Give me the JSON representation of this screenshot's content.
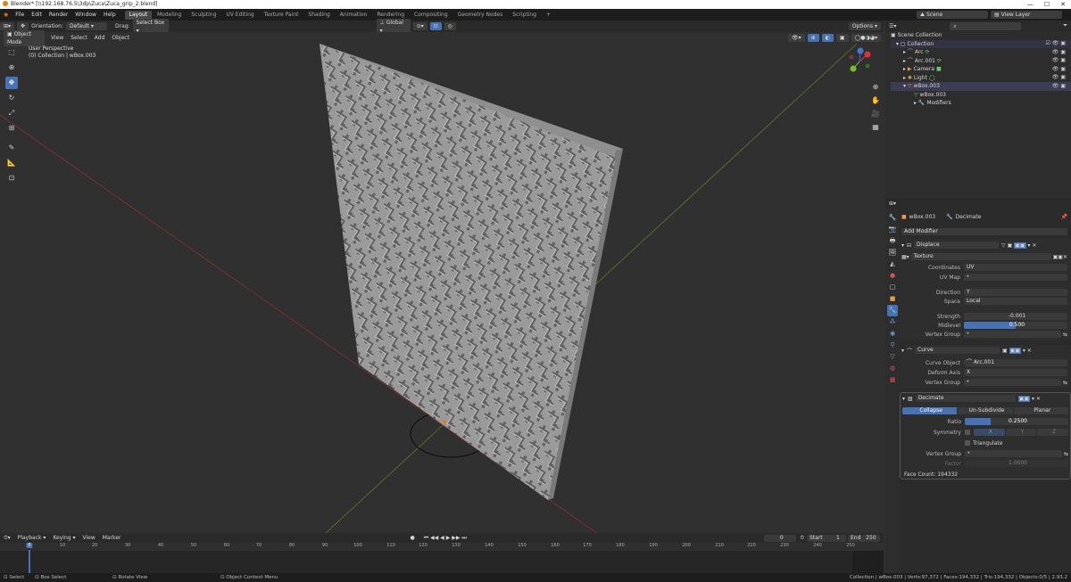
{
  "window": {
    "title": "Blender* [\\\\192.168.76.5\\3dp\\Zuca\\Zuca_grip_2.blend]"
  },
  "menu": [
    "File",
    "Edit",
    "Render",
    "Window",
    "Help"
  ],
  "workspaces": [
    "Layout",
    "Modeling",
    "Sculpting",
    "UV Editing",
    "Texture Paint",
    "Shading",
    "Animation",
    "Rendering",
    "Compositing",
    "Geometry Nodes",
    "Scripting",
    "+"
  ],
  "scene": {
    "name": "Scene",
    "view_layer": "View Layer"
  },
  "toolbar": {
    "orientation_label": "Orientation:",
    "orientation_value": "Default",
    "drag_label": "Drag:",
    "drag_value": "Select Box",
    "transform_orientation": "Global",
    "options": "Options"
  },
  "viewport_header": {
    "mode": "Object Mode",
    "menus": [
      "View",
      "Select",
      "Add",
      "Object"
    ]
  },
  "viewport": {
    "perspective": "User Perspective",
    "collection": "(0) Collection | wBox.003"
  },
  "outliner": {
    "root": "Scene Collection",
    "items": [
      {
        "label": "Collection"
      },
      {
        "label": "Arc"
      },
      {
        "label": "Arc.001"
      },
      {
        "label": "Camera"
      },
      {
        "label": "Light"
      },
      {
        "label": "wBox.003"
      },
      {
        "label": "wBox.003"
      },
      {
        "label": "Modifiers"
      }
    ]
  },
  "properties": {
    "object": "wBox.003",
    "modifier_name": "Decimate",
    "add_modifier": "Add Modifier",
    "displace": {
      "name": "Displace",
      "texture": "Texture",
      "coordinates_label": "Coordinates",
      "coordinates": "UV",
      "uvmap_label": "UV Map",
      "direction_label": "Direction",
      "direction": "Y",
      "space_label": "Space",
      "space": "Local",
      "strength_label": "Strength",
      "strength": "-0.001",
      "midlevel_label": "Midlevel",
      "midlevel": "0.500",
      "vgroup_label": "Vertex Group"
    },
    "curve": {
      "name": "Curve",
      "object_label": "Curve Object",
      "object": "Arc.001",
      "axis_label": "Deform Axis",
      "axis": "X",
      "vgroup_label": "Vertex Group"
    },
    "decimate": {
      "name": "Decimate",
      "tabs": [
        "Collapse",
        "Un-Subdivide",
        "Planar"
      ],
      "ratio_label": "Ratio",
      "ratio": "0.2500",
      "symmetry_label": "Symmetry",
      "axes": [
        "X",
        "Y",
        "Z"
      ],
      "triangulate": "Triangulate",
      "vgroup_label": "Vertex Group",
      "factor_label": "Factor",
      "factor": "1.0000",
      "face_count": "Face Count: 194332"
    }
  },
  "timeline": {
    "menus": [
      "Playback",
      "Keying",
      "View",
      "Marker"
    ],
    "current_frame": "0",
    "start_label": "Start",
    "start": "1",
    "end_label": "End",
    "end": "250",
    "ticks": [
      "0",
      "10",
      "20",
      "30",
      "40",
      "50",
      "60",
      "70",
      "80",
      "90",
      "100",
      "110",
      "120",
      "130",
      "140",
      "150",
      "160",
      "170",
      "180",
      "190",
      "200",
      "210",
      "220",
      "230",
      "240",
      "250"
    ]
  },
  "statusbar": {
    "select": "Select",
    "box_select": "Box Select",
    "rotate": "Rotate View",
    "context": "Object Context Menu",
    "stats": "Collection | wBox.003 | Verts:97,372 | Faces:194,332 | Tris:194,332 | Objects:0/5 | 2.93.2"
  }
}
